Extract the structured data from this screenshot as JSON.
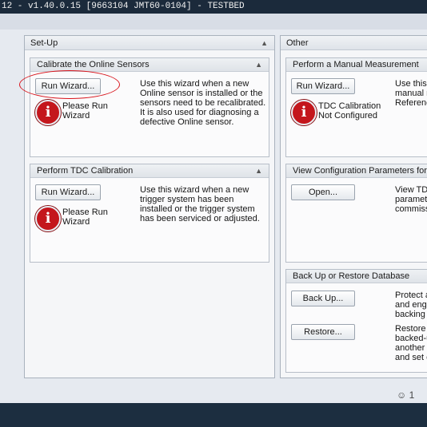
{
  "window": {
    "title": "12 - v1.40.0.15 [9663104 JMT60-0104]  - TESTBED"
  },
  "setup": {
    "header": "Set-Up",
    "calibrate": {
      "header": "Calibrate the Online Sensors",
      "button": "Run Wizard...",
      "desc": [
        "Use this wizard when a new",
        "Online sensor is installed or the",
        "sensors need to be recalibrated.",
        "It is also used for diagnosing a",
        "defective Online sensor."
      ],
      "warning": [
        "Please Run",
        "Wizard"
      ]
    },
    "tdc": {
      "header": "Perform TDC Calibration",
      "button": "Run Wizard...",
      "desc": [
        "Use this wizard when a new",
        "trigger system has been",
        "installed or the trigger system",
        "has been serviced or adjusted."
      ],
      "warning": [
        "Please Run",
        "Wizard"
      ]
    }
  },
  "other": {
    "header": "Other",
    "manual": {
      "header": "Perform a Manual Measurement",
      "button": "Run Wizard...",
      "desc": [
        "Use this",
        "manual n",
        "Referenc"
      ],
      "warning": [
        "TDC Calibration",
        "Not Configured"
      ]
    },
    "config": {
      "header": "View Configuration Parameters for",
      "button": "Open...",
      "desc": [
        "View TD",
        "paramet",
        "commiss"
      ]
    },
    "backup": {
      "header": "Back Up or Restore Database",
      "backup_button": "Back Up...",
      "backup_desc": [
        "Protect a",
        "and engi",
        "backing "
      ],
      "restore_button": "Restore...",
      "restore_desc": [
        "Restore",
        "backed-u",
        "another c",
        "and set e"
      ]
    }
  },
  "icons": {
    "warning": "warning-exclamation-icon",
    "collapse": "chevron-up-icon"
  },
  "colors": {
    "warning": "#c4161c",
    "annotation": "#d8141c",
    "titlebar": "#1b2a3b"
  }
}
